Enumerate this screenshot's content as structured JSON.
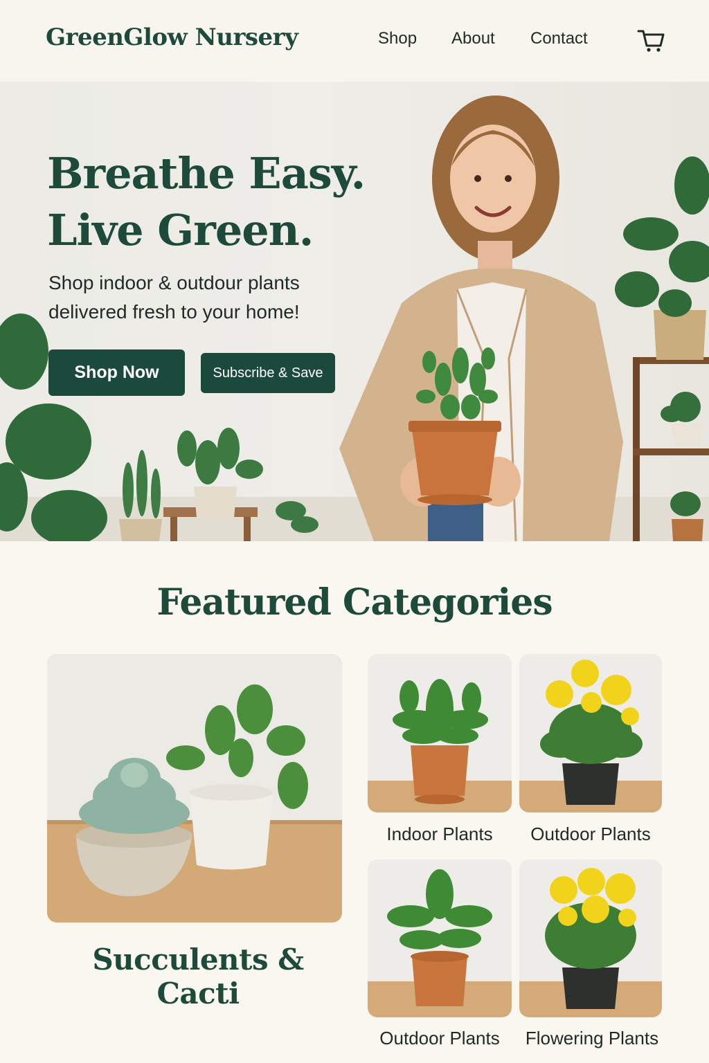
{
  "header": {
    "logo": "GreenGlow Nursery",
    "nav": {
      "shop": "Shop",
      "about": "About",
      "contact": "Contact"
    },
    "cart_icon": "cart-icon"
  },
  "hero": {
    "title_line1": "Breathe Easy.",
    "title_line2": "Live Green.",
    "subtitle": "Shop indoor & outdour plants delivered fresh to your home!",
    "primary_button": "Shop Now",
    "secondary_button": "Subscribe & Save"
  },
  "featured": {
    "title": "Featured Categories",
    "main_category": "Succulents & Cacti",
    "categories": [
      {
        "label": "Indoor Plants"
      },
      {
        "label": "Outdoor Plants"
      },
      {
        "label": "Outdoor Plants"
      },
      {
        "label": "Flowering Plants"
      }
    ]
  },
  "colors": {
    "brand_green": "#1b4a3c",
    "background": "#faf7f1",
    "text_dark": "#1f2a26"
  }
}
